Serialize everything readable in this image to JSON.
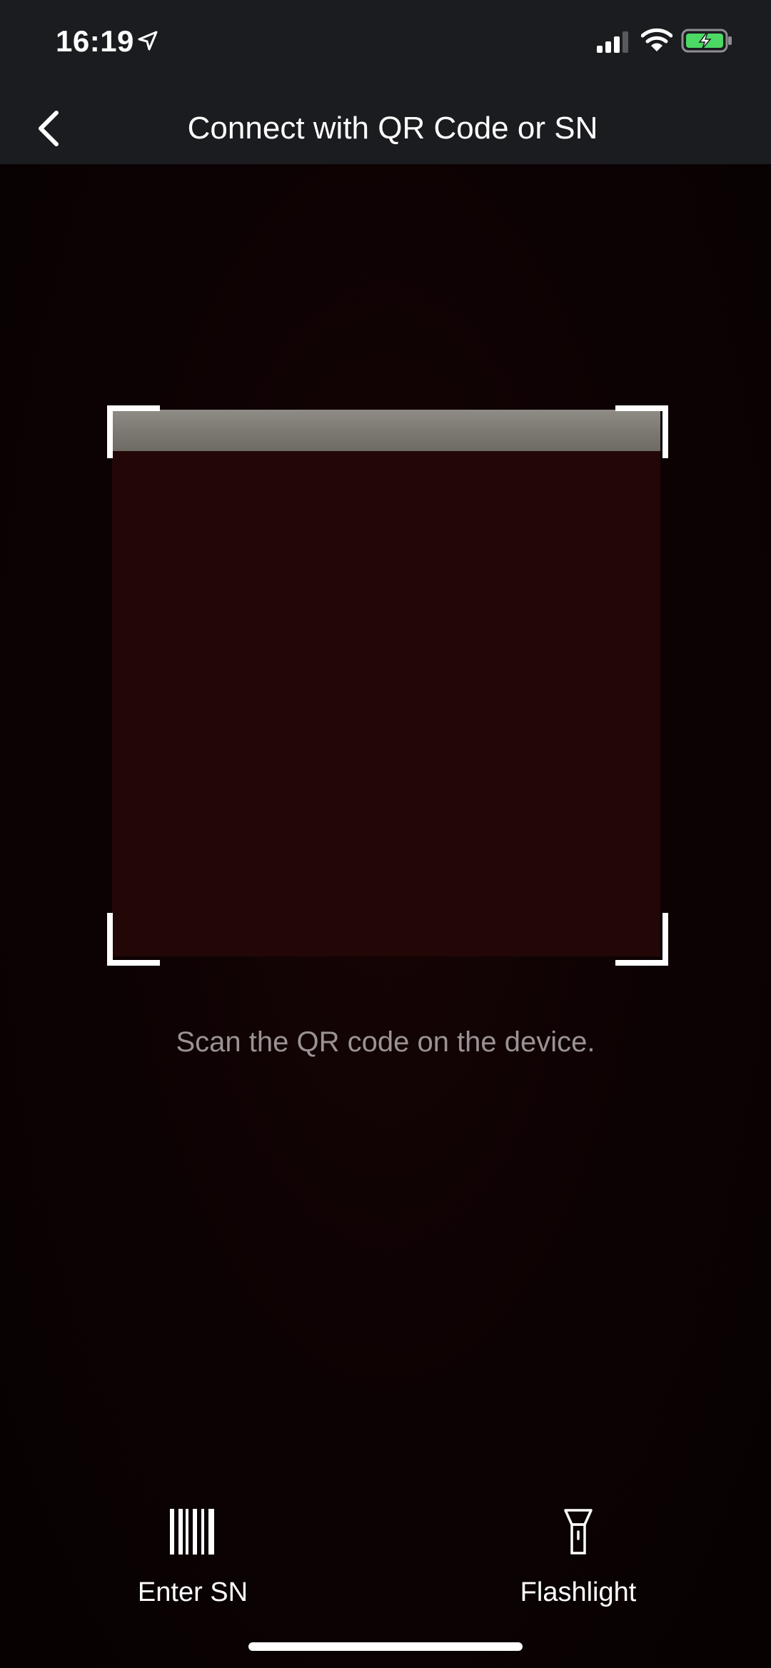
{
  "status_bar": {
    "time": "16:19",
    "icons": [
      "location-arrow-icon",
      "cellular-signal-icon",
      "wifi-icon",
      "battery-charging-icon"
    ],
    "battery_color": "#4cd964"
  },
  "nav": {
    "title": "Connect with QR Code or SN",
    "back_icon": "chevron-left-icon"
  },
  "scanner": {
    "hint": "Scan the QR code on the device.",
    "frame_color": "#ffffff"
  },
  "actions": [
    {
      "label": "Enter SN",
      "icon": "barcode-icon"
    },
    {
      "label": "Flashlight",
      "icon": "flashlight-icon"
    }
  ]
}
